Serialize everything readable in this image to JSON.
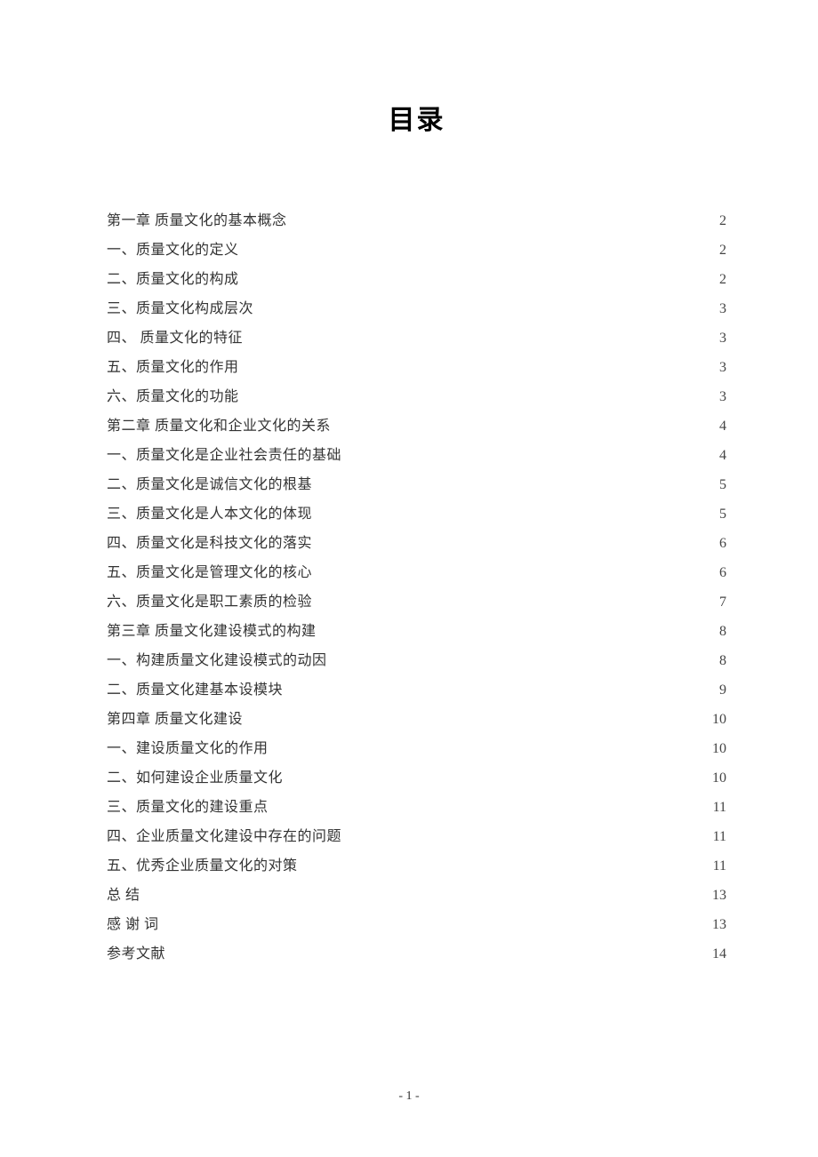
{
  "title": "目录",
  "toc": [
    {
      "title": "第一章  质量文化的基本概念",
      "page": "2"
    },
    {
      "title": "一、质量文化的定义",
      "page": "2"
    },
    {
      "title": "二、质量文化的构成",
      "page": "2"
    },
    {
      "title": "三、质量文化构成层次",
      "page": "3"
    },
    {
      "title": "四、 质量文化的特征",
      "page": "3"
    },
    {
      "title": "五、质量文化的作用",
      "page": "3"
    },
    {
      "title": "六、质量文化的功能",
      "page": "3"
    },
    {
      "title": "第二章 质量文化和企业文化的关系",
      "page": "4"
    },
    {
      "title": "一、质量文化是企业社会责任的基础",
      "page": "4"
    },
    {
      "title": "二、质量文化是诚信文化的根基",
      "page": "5"
    },
    {
      "title": "三、质量文化是人本文化的体现",
      "page": "5"
    },
    {
      "title": "四、质量文化是科技文化的落实",
      "page": "6"
    },
    {
      "title": "五、质量文化是管理文化的核心",
      "page": "6"
    },
    {
      "title": "六、质量文化是职工素质的检验",
      "page": "7"
    },
    {
      "title": "第三章   质量文化建设模式的构建",
      "page": "8"
    },
    {
      "title": "一、构建质量文化建设模式的动因",
      "page": "8"
    },
    {
      "title": "二、质量文化建基本设模块",
      "page": "9"
    },
    {
      "title": "第四章  质量文化建设",
      "page": "10"
    },
    {
      "title": "一、建设质量文化的作用",
      "page": "10"
    },
    {
      "title": "二、如何建设企业质量文化",
      "page": "10"
    },
    {
      "title": "三、质量文化的建设重点",
      "page": "11"
    },
    {
      "title": "四、企业质量文化建设中存在的问题",
      "page": "11"
    },
    {
      "title": "五、优秀企业质量文化的对策",
      "page": "11"
    },
    {
      "title": "总   结",
      "page": "13"
    },
    {
      "title": "感 谢 词",
      "page": "13"
    },
    {
      "title": "参考文献",
      "page": "14"
    }
  ],
  "page_number": "- 1 -"
}
